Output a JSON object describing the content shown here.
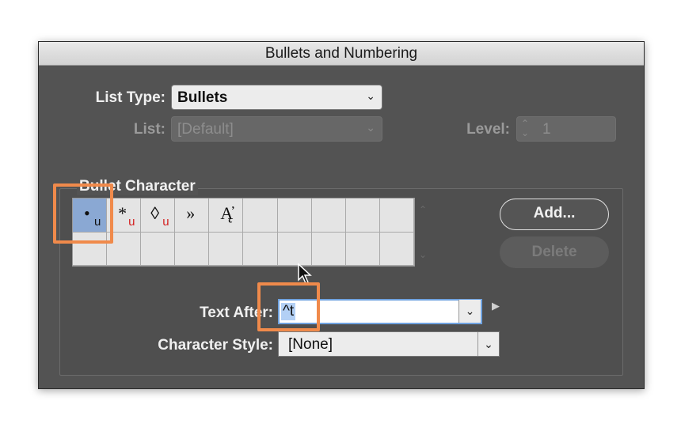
{
  "dialog": {
    "title": "Bullets and Numbering"
  },
  "list_type": {
    "label": "List Type:",
    "value": "Bullets"
  },
  "list": {
    "label": "List:",
    "value": "[Default]"
  },
  "level": {
    "label": "Level:",
    "value": "1"
  },
  "bullet_character": {
    "title": "Bullet Character",
    "cells": [
      {
        "glyph": "•",
        "sub": "u",
        "selected": true
      },
      {
        "glyph": "*",
        "sub": "u"
      },
      {
        "glyph": "◊",
        "sub": "u"
      },
      {
        "glyph": "»",
        "sub": ""
      },
      {
        "glyph": "Ą̓",
        "sub": ""
      }
    ],
    "add_label": "Add...",
    "delete_label": "Delete"
  },
  "text_after": {
    "label": "Text After:",
    "value": "^t"
  },
  "character_style": {
    "label": "Character Style:",
    "value": "[None]"
  },
  "colors": {
    "highlight": "#f08a4b",
    "selection": "#8aa8d3"
  },
  "icons": {
    "dropdown": "chevron-down-icon",
    "stepper": "stepper-icon",
    "cursor": "mouse-pointer-icon"
  }
}
